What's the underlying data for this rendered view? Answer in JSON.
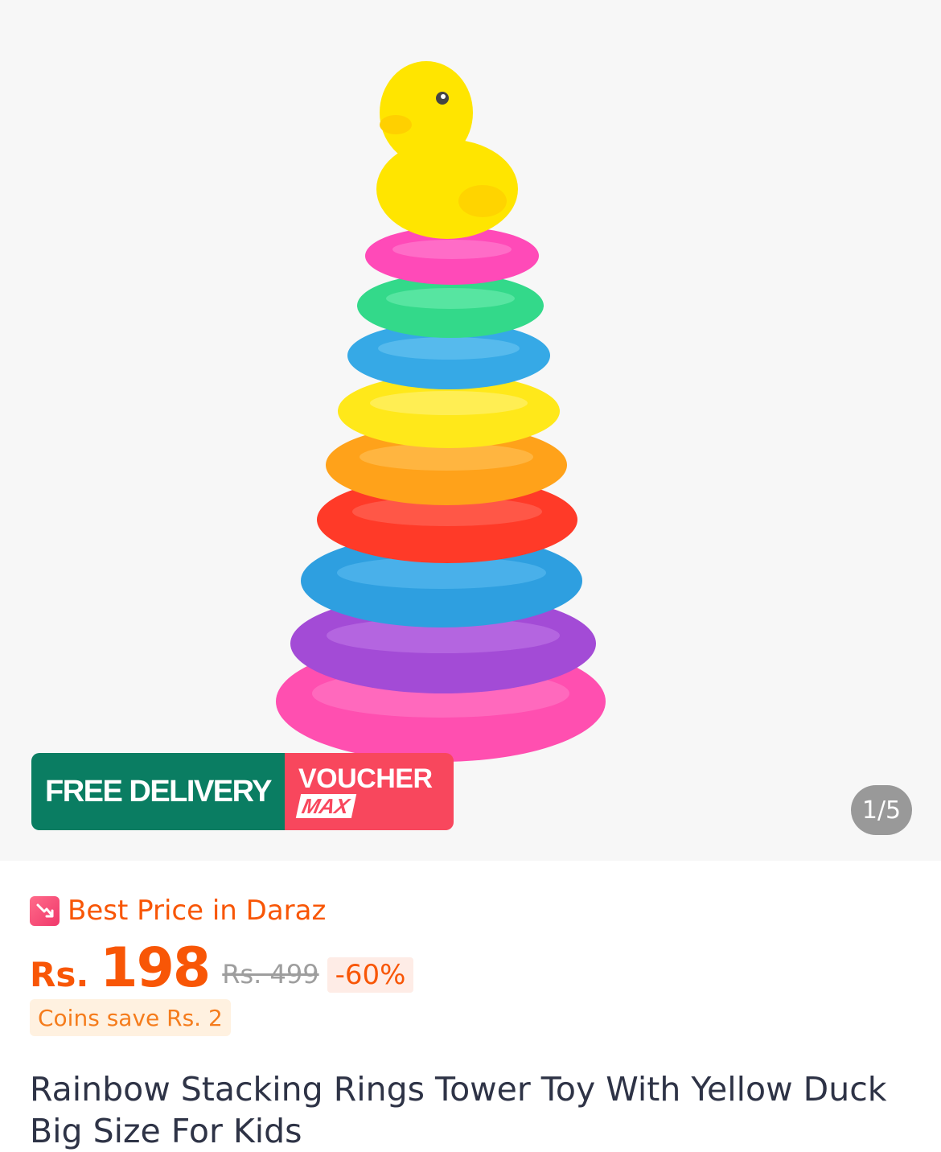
{
  "gallery": {
    "counter": "1/5",
    "image_position": 1,
    "image_count": 5
  },
  "promo": {
    "free_delivery": "FREE DELIVERY",
    "voucher_line1": "VOUCHER",
    "voucher_line2": "MAX"
  },
  "pricing": {
    "best_price_label": "Best Price in Daraz",
    "currency": "Rs.",
    "price": "198",
    "original_price": "Rs. 499",
    "discount": "-60%",
    "coins_note": "Coins save Rs. 2"
  },
  "product": {
    "title": "Rainbow Stacking Rings Tower Toy With Yellow Duck Big Size For Kids"
  },
  "colors": {
    "accent": "#f85606",
    "free_delivery_bg": "#0a7d62",
    "voucher_bg": "#f8475d"
  }
}
